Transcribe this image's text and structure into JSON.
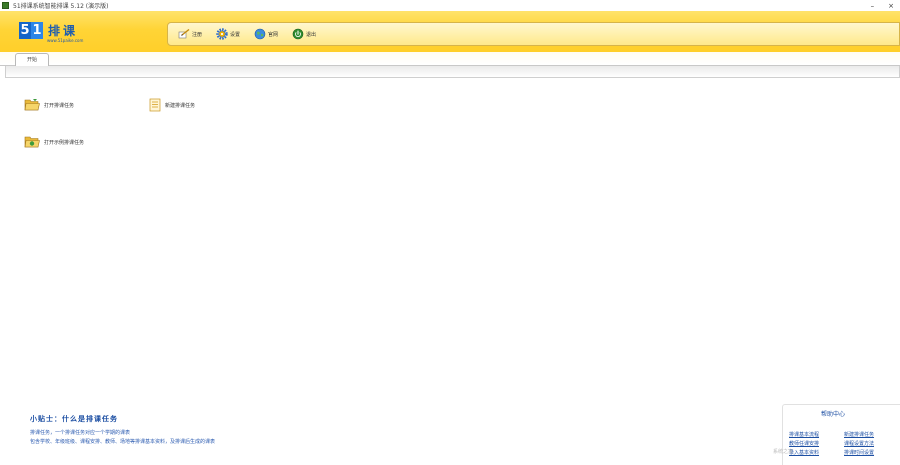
{
  "window": {
    "title": "51排课系统智能排课 5.12 (演示版)",
    "minimize": "–",
    "close": "×"
  },
  "banner": {
    "logo_digit_5": "5",
    "logo_digit_1": "1",
    "logo_text": "排课",
    "logo_url": "www.51paike.com",
    "toolbar": [
      {
        "label": "注册",
        "icon": "register-icon"
      },
      {
        "label": "设置",
        "icon": "settings-gear-icon"
      },
      {
        "label": "官网",
        "icon": "globe-icon"
      },
      {
        "label": "退出",
        "icon": "exit-icon"
      }
    ]
  },
  "tabs": [
    {
      "label": "开始"
    }
  ],
  "shortcuts": [
    {
      "label": "打开排课任务",
      "icon": "open-folder-icon"
    },
    {
      "label": "新建排课任务",
      "icon": "new-document-icon"
    },
    {
      "label": "打开示例排课任务",
      "icon": "example-folder-icon"
    }
  ],
  "tip": {
    "title": "小贴士：什么是排课任务",
    "lines": [
      "排课任务，一个排课任务对应一个学期的课表",
      "包含学校、年级班级、课程安排、教师、场地等排课基本资料，及排课后生成的课表"
    ]
  },
  "help": {
    "title": "帮助中心",
    "links": [
      "排课基本流程",
      "新建排课任务",
      "教师任课安排",
      "课程设置方法",
      "录入基本资料",
      "排课时间设置"
    ]
  },
  "watermark": "系统之家"
}
